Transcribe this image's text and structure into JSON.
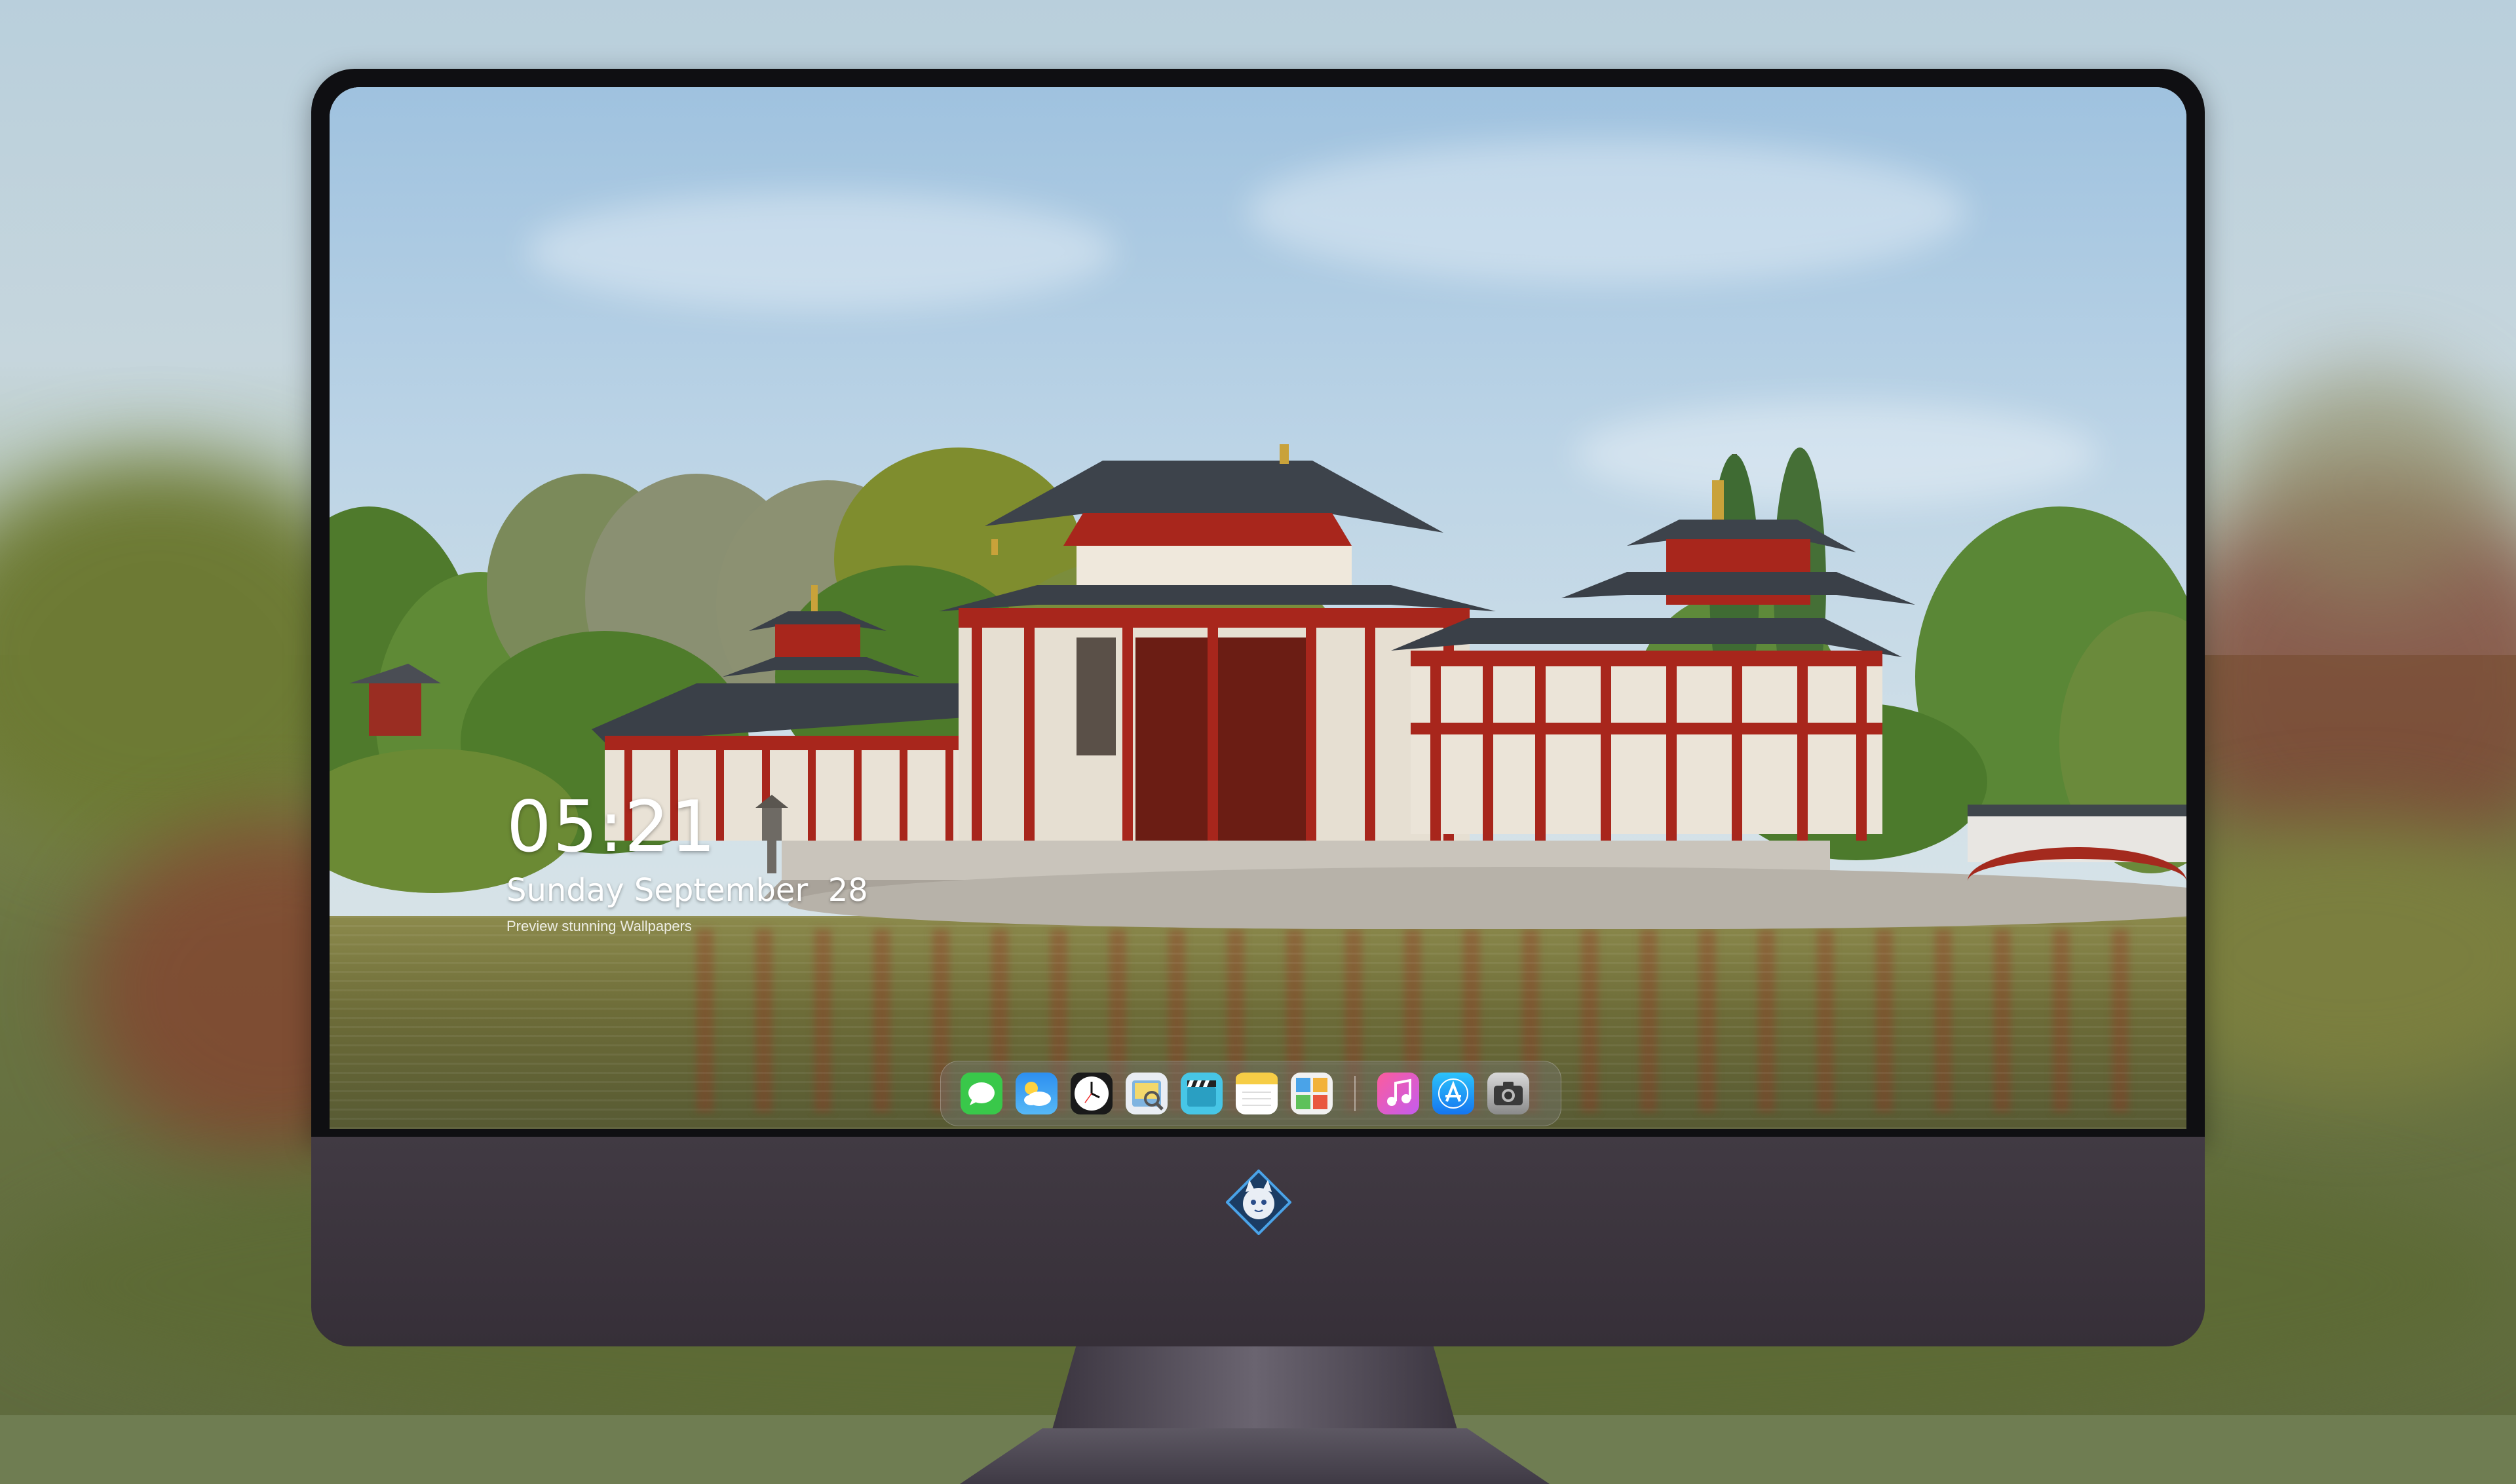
{
  "lock_screen": {
    "time": "05:21",
    "date": "Sunday September  28",
    "caption": "Preview stunning Wallpapers"
  },
  "dock": {
    "apps": [
      {
        "name": "Messages",
        "icon": "messages-icon"
      },
      {
        "name": "Weather",
        "icon": "weather-icon"
      },
      {
        "name": "Clock",
        "icon": "clock-icon"
      },
      {
        "name": "Preview",
        "icon": "preview-icon"
      },
      {
        "name": "Clips",
        "icon": "clips-icon"
      },
      {
        "name": "Notes",
        "icon": "notes-icon"
      },
      {
        "name": "Photo Booth",
        "icon": "photo-booth-icon"
      },
      {
        "name": "iTunes",
        "icon": "itunes-icon"
      },
      {
        "name": "App Store",
        "icon": "app-store-icon"
      },
      {
        "name": "Camera",
        "icon": "camera-icon"
      }
    ]
  },
  "colors": {
    "temple_red": "#a8261c",
    "roof": "#3a4048",
    "bezel": "#0f0f12",
    "chin": "#3b343d"
  }
}
